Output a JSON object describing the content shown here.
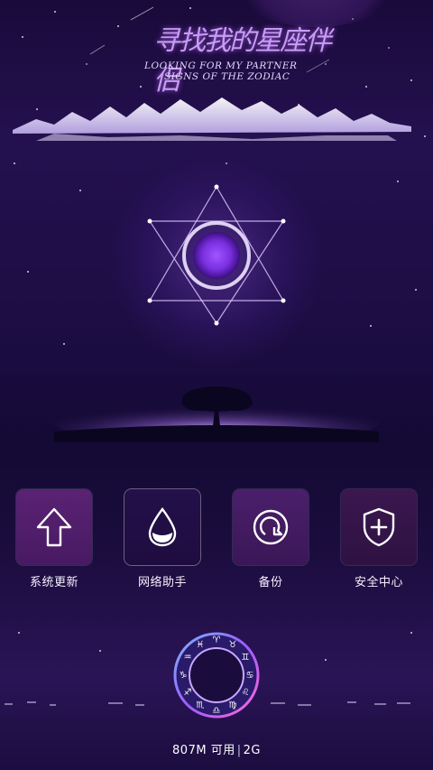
{
  "header": {
    "title_cn": "寻找我的星座伴侣",
    "title_en_line1": "LOOKING FOR MY PARTNER",
    "title_en_line2": "SIGNS OF THE ZODIAC"
  },
  "apps": [
    {
      "label": "系统更新",
      "icon": "arrow-up-icon"
    },
    {
      "label": "网络助手",
      "icon": "water-drop-icon"
    },
    {
      "label": "备份",
      "icon": "backup-icon"
    },
    {
      "label": "安全中心",
      "icon": "shield-plus-icon"
    }
  ],
  "footer": {
    "memory": "807M 可用",
    "network": "2G"
  },
  "colors": {
    "background_top": "#1a0a3a",
    "tile_purple": "#5a2273",
    "accent_glow": "#c89cf5"
  }
}
